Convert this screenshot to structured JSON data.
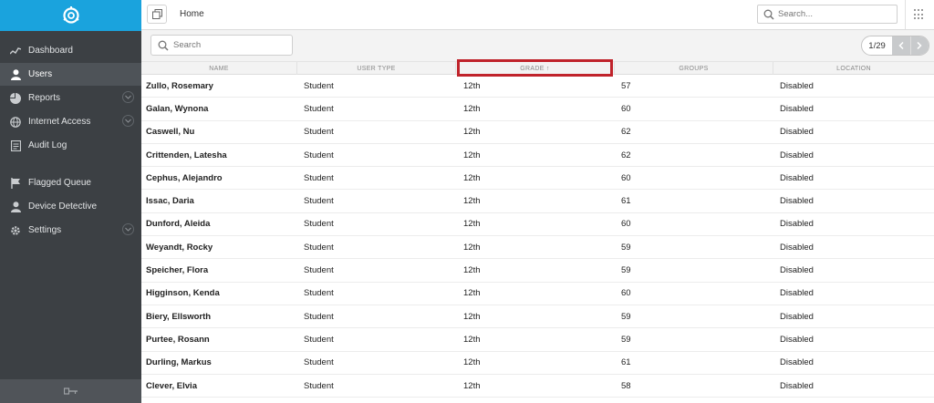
{
  "sidebar": {
    "items": [
      {
        "label": "Dashboard",
        "icon": "activity-icon"
      },
      {
        "label": "Users",
        "icon": "user-icon",
        "active": true
      },
      {
        "label": "Reports",
        "icon": "pie-chart-icon",
        "expandable": true
      },
      {
        "label": "Internet Access",
        "icon": "globe-icon",
        "expandable": true
      },
      {
        "label": "Audit Log",
        "icon": "log-icon"
      },
      {
        "label": "Flagged Queue",
        "icon": "flag-icon"
      },
      {
        "label": "Device Detective",
        "icon": "user-icon"
      },
      {
        "label": "Settings",
        "icon": "gear-icon",
        "expandable": true
      }
    ]
  },
  "topbar": {
    "title": "Home",
    "search_placeholder": "Search..."
  },
  "subbar": {
    "search_placeholder": "Search",
    "page_count": "1/29"
  },
  "table": {
    "columns": [
      "NAME",
      "USER TYPE",
      "GRADE ↑",
      "GROUPS",
      "LOCATION"
    ],
    "rows": [
      [
        "Zullo, Rosemary",
        "Student",
        "12th",
        "57",
        "Disabled"
      ],
      [
        "Galan, Wynona",
        "Student",
        "12th",
        "60",
        "Disabled"
      ],
      [
        "Caswell, Nu",
        "Student",
        "12th",
        "62",
        "Disabled"
      ],
      [
        "Crittenden, Latesha",
        "Student",
        "12th",
        "62",
        "Disabled"
      ],
      [
        "Cephus, Alejandro",
        "Student",
        "12th",
        "60",
        "Disabled"
      ],
      [
        "Issac, Daria",
        "Student",
        "12th",
        "61",
        "Disabled"
      ],
      [
        "Dunford, Aleida",
        "Student",
        "12th",
        "60",
        "Disabled"
      ],
      [
        "Weyandt, Rocky",
        "Student",
        "12th",
        "59",
        "Disabled"
      ],
      [
        "Speicher, Flora",
        "Student",
        "12th",
        "59",
        "Disabled"
      ],
      [
        "Higginson, Kenda",
        "Student",
        "12th",
        "60",
        "Disabled"
      ],
      [
        "Biery, Ellsworth",
        "Student",
        "12th",
        "59",
        "Disabled"
      ],
      [
        "Purtee, Rosann",
        "Student",
        "12th",
        "59",
        "Disabled"
      ],
      [
        "Durling, Markus",
        "Student",
        "12th",
        "61",
        "Disabled"
      ],
      [
        "Clever, Elvia",
        "Student",
        "12th",
        "58",
        "Disabled"
      ]
    ]
  },
  "colors": {
    "sidebar_bg": "#3c4044",
    "logo_bar": "#1aa3dd",
    "highlight_border": "#c0232b"
  }
}
